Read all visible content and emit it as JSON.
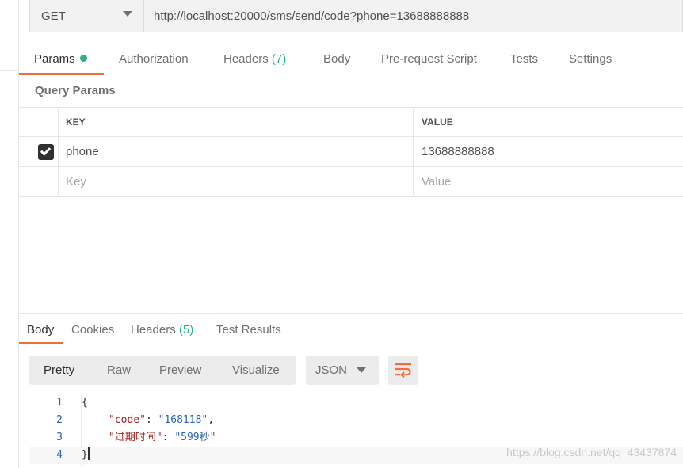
{
  "request": {
    "method": "GET",
    "url": "http://localhost:20000/sms/send/code?phone=13688888888"
  },
  "request_tabs": [
    {
      "label": "Params",
      "count": "",
      "active": true
    },
    {
      "label": "Authorization",
      "count": ""
    },
    {
      "label": "Headers",
      "count": "(7)"
    },
    {
      "label": "Body",
      "count": ""
    },
    {
      "label": "Pre-request Script",
      "count": ""
    },
    {
      "label": "Tests",
      "count": ""
    },
    {
      "label": "Settings",
      "count": ""
    }
  ],
  "query_params": {
    "title": "Query Params",
    "columns": {
      "key": "KEY",
      "value": "VALUE"
    },
    "rows": [
      {
        "checked": true,
        "key": "phone",
        "value": "13688888888"
      }
    ],
    "placeholder": {
      "key": "Key",
      "value": "Value"
    }
  },
  "response_tabs": [
    {
      "label": "Body",
      "count": "",
      "active": true
    },
    {
      "label": "Cookies",
      "count": ""
    },
    {
      "label": "Headers",
      "count": "(5)"
    },
    {
      "label": "Test Results",
      "count": ""
    }
  ],
  "format_buttons": [
    "Pretty",
    "Raw",
    "Preview",
    "Visualize"
  ],
  "format_select": "JSON",
  "code_lines": [
    {
      "num": "1",
      "text": "{"
    },
    {
      "num": "2",
      "key": "\"code\"",
      "value": "\"168118\"",
      "trail": ","
    },
    {
      "num": "3",
      "key": "\"过期时间\"",
      "value": "\"599秒\"",
      "trail": ""
    },
    {
      "num": "4",
      "text": "}"
    }
  ],
  "watermark": "https://blog.csdn.net/qq_43437874",
  "colors": {
    "accent": "#f26b3a",
    "success": "#26b47f",
    "code_key": "#a11e1e",
    "code_string": "#2b63b5"
  }
}
